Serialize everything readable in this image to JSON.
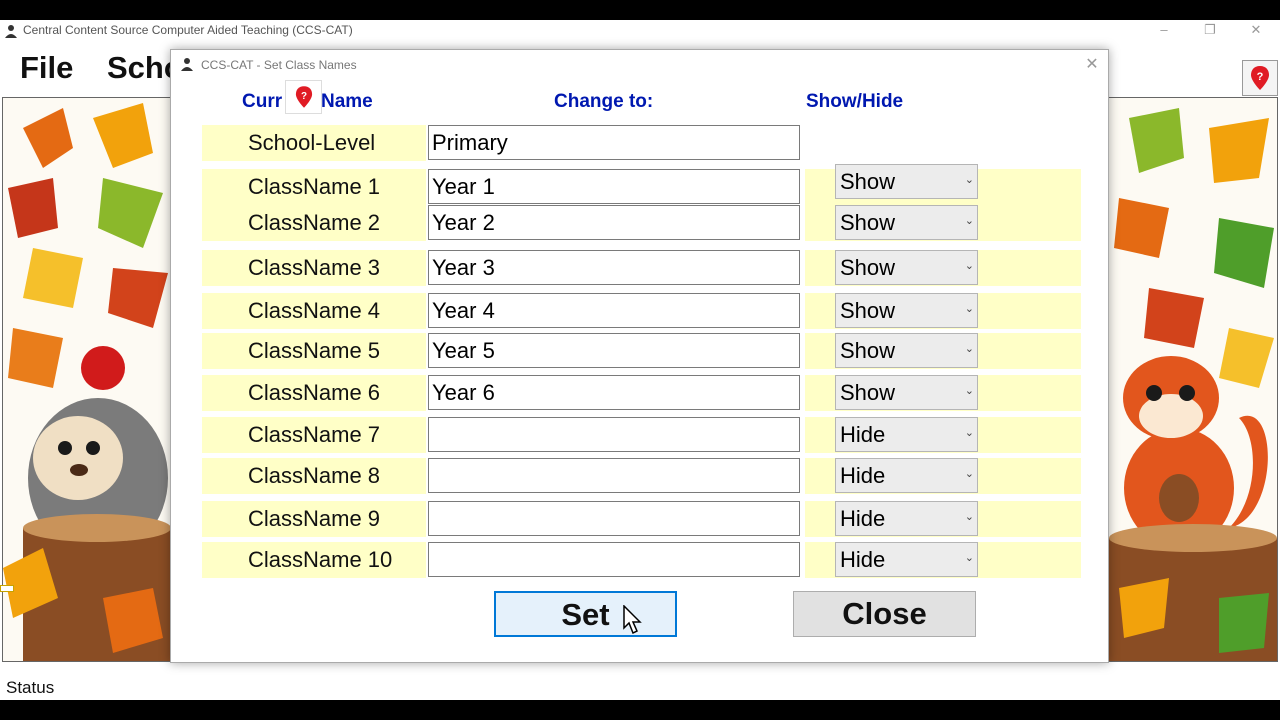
{
  "app": {
    "title": "Central Content Source Computer Aided Teaching  (CCS-CAT)",
    "menu": [
      "File",
      "Scho"
    ],
    "status": "Status",
    "controls": {
      "minimize": "–",
      "restore": "❐",
      "close": "✕"
    }
  },
  "dialog": {
    "title": "CCS-CAT - Set Class Names",
    "close_glyph": "✕",
    "headers": {
      "current_left": "Curr",
      "current_right": "Name",
      "change": "Change to:",
      "showhide": "Show/Hide"
    },
    "school_level": {
      "label": "School-Level",
      "value": "Primary"
    },
    "rows": [
      {
        "label": "ClassName 1",
        "value": "Year 1",
        "visibility": "Show"
      },
      {
        "label": "ClassName 2",
        "value": "Year 2",
        "visibility": "Show"
      },
      {
        "label": "ClassName 3",
        "value": "Year 3",
        "visibility": "Show"
      },
      {
        "label": "ClassName 4",
        "value": "Year 4",
        "visibility": "Show"
      },
      {
        "label": "ClassName 5",
        "value": "Year 5",
        "visibility": "Show"
      },
      {
        "label": "ClassName 6",
        "value": "Year 6",
        "visibility": "Show"
      },
      {
        "label": "ClassName 7",
        "value": "",
        "visibility": "Hide"
      },
      {
        "label": "ClassName 8",
        "value": "",
        "visibility": "Hide"
      },
      {
        "label": "ClassName 9",
        "value": "",
        "visibility": "Hide"
      },
      {
        "label": "ClassName 10",
        "value": "",
        "visibility": "Hide"
      }
    ],
    "buttons": {
      "set": "Set",
      "close": "Close"
    }
  },
  "colors": {
    "row_highlight": "#ffffc7",
    "header_text": "#0018b0",
    "accent": "#0078d7",
    "pin_red": "#e01b24"
  }
}
